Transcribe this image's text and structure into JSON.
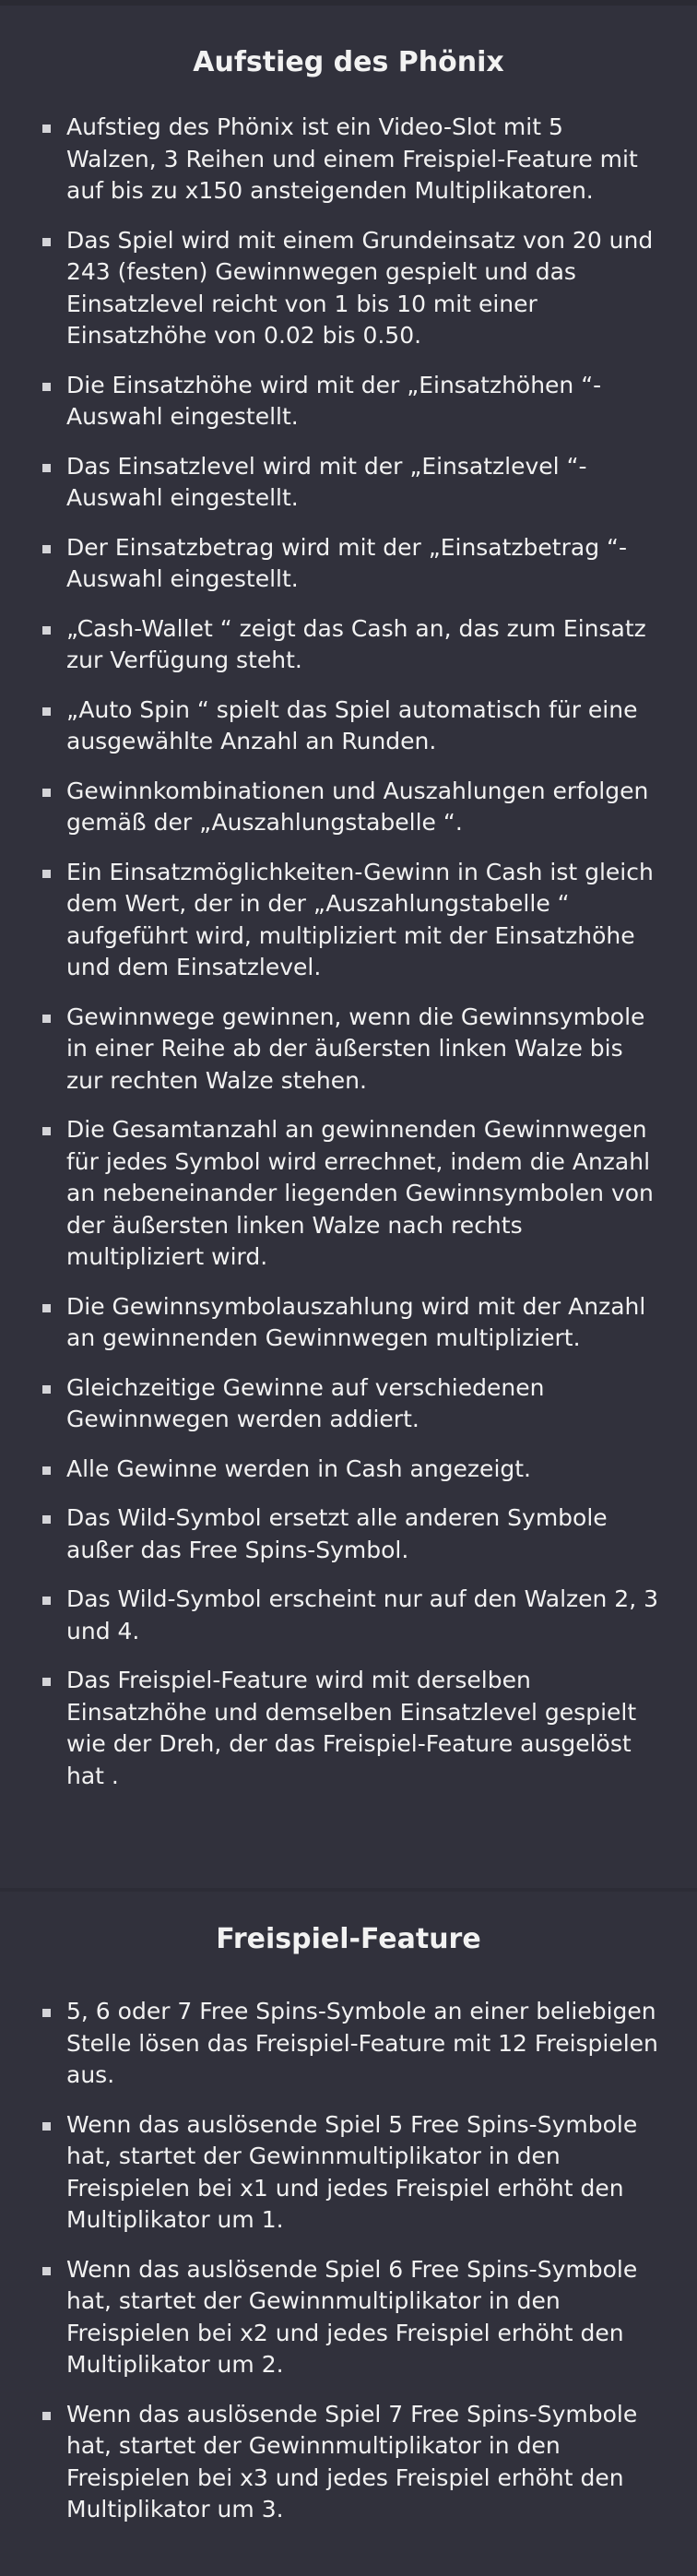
{
  "sections": [
    {
      "title": "Aufstieg des Phönix",
      "items": [
        "Aufstieg des Phönix ist ein Video-Slot mit 5 Walzen, 3 Reihen und einem Freispiel-Feature mit auf bis zu x150 ansteigenden Multiplikatoren.",
        "Das Spiel wird mit einem Grundeinsatz von 20 und 243 (festen) Gewinnwegen gespielt und das Einsatzlevel reicht von 1 bis 10 mit einer Einsatzhöhe von 0.02 bis 0.50.",
        "Die Einsatzhöhe wird mit der „Einsatzhöhen “-Auswahl eingestellt.",
        "Das Einsatzlevel wird mit der „Einsatzlevel “-Auswahl eingestellt.",
        "Der Einsatzbetrag wird mit der „Einsatzbetrag “-Auswahl eingestellt.",
        "„Cash-Wallet “ zeigt das Cash an, das zum Einsatz zur Verfügung steht.",
        "„Auto Spin “ spielt das Spiel automatisch für eine ausgewählte Anzahl an Runden.",
        "Gewinnkombinationen und Auszahlungen erfolgen gemäß der „Auszahlungstabelle “.",
        "Ein Einsatzmöglichkeiten-Gewinn in Cash ist gleich dem Wert, der in der „Auszahlungstabelle “ aufgeführt wird, multipliziert mit der Einsatzhöhe und dem Einsatzlevel.",
        "Gewinnwege gewinnen, wenn die Gewinnsymbole in einer Reihe ab der äußersten linken Walze bis zur rechten Walze stehen.",
        "Die Gesamtanzahl an gewinnenden Gewinnwegen für jedes Symbol wird errechnet, indem die Anzahl an nebeneinander liegenden Gewinnsymbolen von der äußersten linken Walze nach rechts multipliziert wird.",
        "Die Gewinnsymbolauszahlung wird mit der Anzahl an gewinnenden Gewinnwegen multipliziert.",
        "Gleichzeitige Gewinne auf verschiedenen Gewinnwegen werden addiert.",
        "Alle Gewinne werden in Cash angezeigt.",
        "Das Wild-Symbol ersetzt alle anderen Symbole außer das Free Spins-Symbol.",
        "Das Wild-Symbol erscheint nur auf den Walzen 2, 3 und 4.",
        "Das Freispiel-Feature wird mit derselben Einsatzhöhe und demselben Einsatzlevel gespielt wie der Dreh, der das Freispiel-Feature ausgelöst hat ."
      ]
    },
    {
      "title": "Freispiel-Feature",
      "items": [
        "5, 6 oder 7 Free Spins-Symbole an einer beliebigen Stelle lösen das Freispiel-Feature mit 12 Freispielen aus.",
        "Wenn das auslösende Spiel 5 Free Spins-Symbole hat, startet der Gewinnmultiplikator in den Freispielen bei x1 und jedes Freispiel erhöht den Multiplikator um 1.",
        "Wenn das auslösende Spiel 6 Free Spins-Symbole hat, startet der Gewinnmultiplikator in den Freispielen bei x2 und jedes Freispiel erhöht den Multiplikator um 2.",
        "Wenn das auslösende Spiel 7 Free Spins-Symbole hat, startet der Gewinnmultiplikator in den Freispielen bei x3 und jedes Freispiel erhöht den Multiplikator um 3."
      ]
    }
  ]
}
